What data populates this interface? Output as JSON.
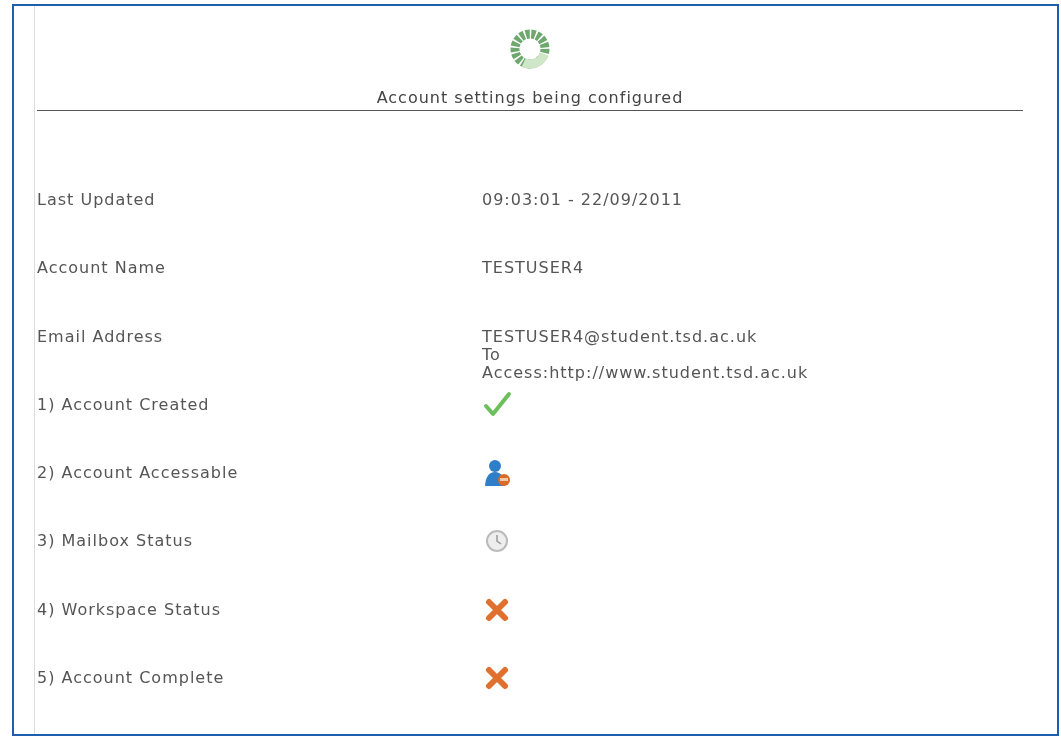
{
  "heading": "Account settings being configured",
  "fields": [
    {
      "label": "Last Updated",
      "lines": [
        "09:03:01 - 22/09/2011"
      ]
    },
    {
      "label": "Account Name",
      "lines": [
        "TESTUSER4"
      ]
    },
    {
      "label": "Email Address",
      "lines": [
        "TESTUSER4@student.tsd.ac.uk",
        "To",
        "Access:http://www.student.tsd.ac.uk"
      ]
    }
  ],
  "steps": [
    {
      "label": "1) Account Created",
      "kind": "done"
    },
    {
      "label": "2) Account Accessable",
      "kind": "user"
    },
    {
      "label": "3) Mailbox Status",
      "kind": "pending"
    },
    {
      "label": "4) Workspace Status",
      "kind": "failed"
    },
    {
      "label": "5) Account Complete",
      "kind": "failed"
    }
  ]
}
